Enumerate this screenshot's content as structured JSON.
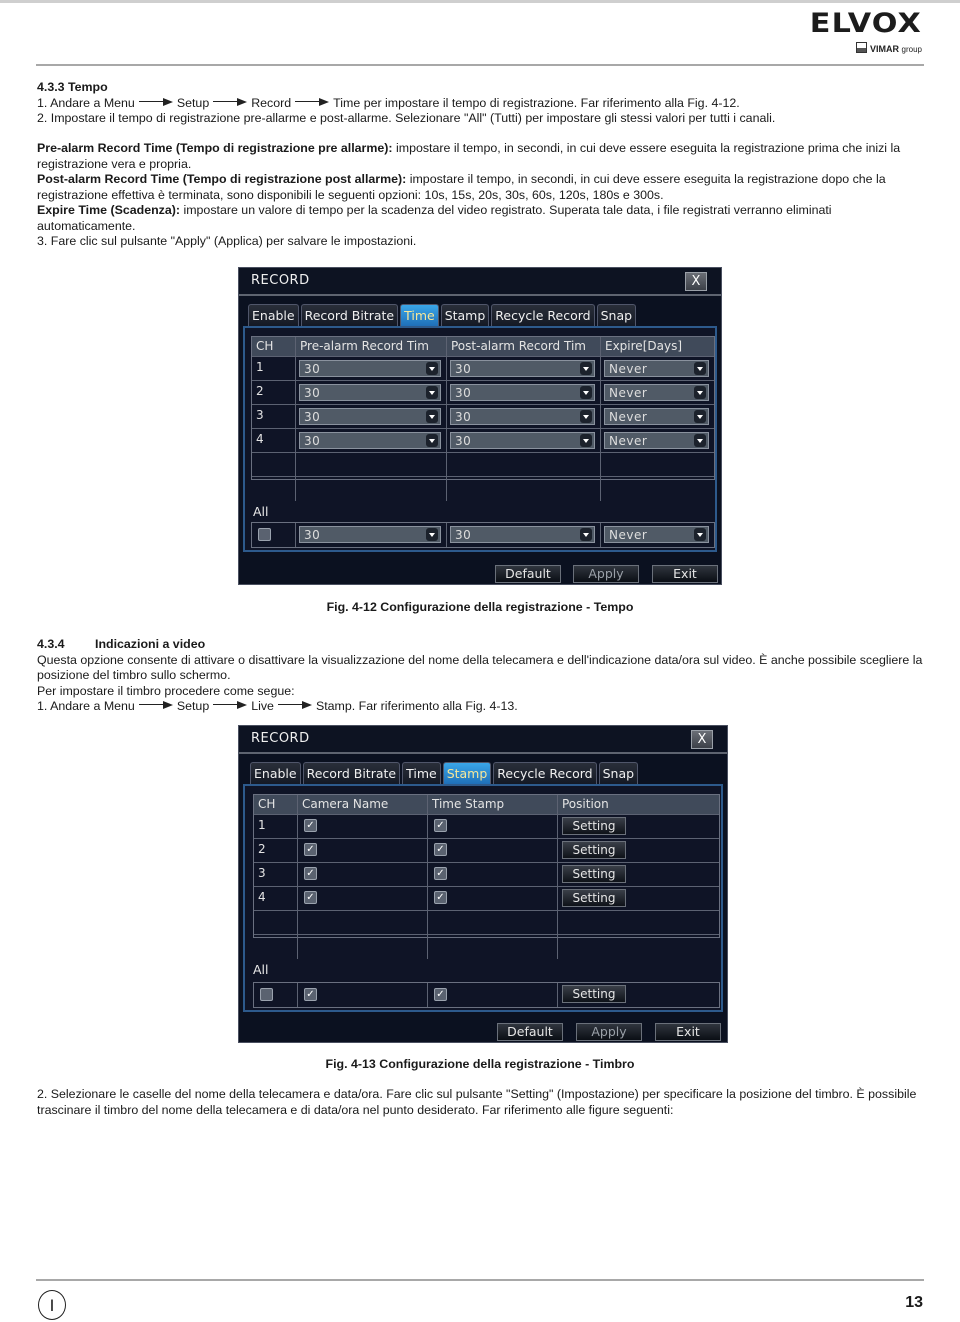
{
  "header": {
    "brand": "ELVOX",
    "sub_brand": "VIMAR",
    "sub_brand_suffix": "group"
  },
  "section_433": {
    "title": "4.3.3 Tempo",
    "step1": {
      "prefix": "1. Andare a Menu",
      "path": [
        "Setup",
        "Record"
      ],
      "suffix": "Time per impostare il tempo di registrazione. Far riferimento alla Fig. 4-12."
    },
    "step2": "2. Impostare il tempo di registrazione pre-allarme e post-allarme. Selezionare \"All\" (Tutti) per impostare gli stessi valori per tutti i canali.",
    "pre_alarm": {
      "label": "Pre-alarm Record Time (Tempo di registrazione pre allarme):",
      "text": " impostare il tempo, in secondi, in cui deve essere eseguita la registrazione prima che inizi la registrazione vera e propria."
    },
    "post_alarm": {
      "label": "Post-alarm Record Time (Tempo di registrazione post allarme):",
      "text": " impostare il tempo, in secondi, in cui deve essere eseguita la registrazione dopo che la registrazione effettiva è terminata, sono disponibili le seguenti opzioni: 10s, 15s, 20s, 30s, 60s, 120s, 180s e 300s."
    },
    "expire": {
      "label": "Expire Time (Scadenza):",
      "text": " impostare un valore di tempo per la scadenza del video registrato. Superata tale data, i file registrati verranno eliminati automaticamente."
    },
    "step3": "3. Fare clic sul pulsante \"Apply\" (Applica) per salvare le impostazioni."
  },
  "fig412": {
    "caption": "Fig. 4-12 Configurazione della registrazione - Tempo",
    "dialog": {
      "title": "RECORD",
      "close": "X",
      "tabs": [
        "Enable",
        "Record Bitrate",
        "Time",
        "Stamp",
        "Recycle Record",
        "Snap"
      ],
      "active_tab": "Time",
      "columns": [
        "CH",
        "Pre-alarm Record Tim",
        "Post-alarm Record Tim",
        "Expire[Days]"
      ],
      "rows": [
        {
          "ch": "1",
          "pre": "30",
          "post": "30",
          "expire": "Never"
        },
        {
          "ch": "2",
          "pre": "30",
          "post": "30",
          "expire": "Never"
        },
        {
          "ch": "3",
          "pre": "30",
          "post": "30",
          "expire": "Never"
        },
        {
          "ch": "4",
          "pre": "30",
          "post": "30",
          "expire": "Never"
        }
      ],
      "all_label": "All",
      "all_row": {
        "checked": false,
        "pre": "30",
        "post": "30",
        "expire": "Never"
      },
      "buttons": [
        "Default",
        "Apply",
        "Exit"
      ]
    }
  },
  "section_434": {
    "number": "4.3.4",
    "title": "Indicazioni a video",
    "intro": "Questa opzione consente di attivare o disattivare la visualizzazione del nome della telecamera e dell'indicazione data/ora sul video. È anche possibile scegliere la posizione del timbro sullo schermo.",
    "how": "Per impostare il timbro procedere come segue:",
    "step1": {
      "prefix": "1. Andare a Menu",
      "path": [
        "Setup",
        "Live"
      ],
      "suffix": "Stamp. Far riferimento alla Fig. 4-13."
    },
    "step2": "2. Selezionare le caselle del nome della telecamera e data/ora. Fare clic sul pulsante \"Setting\" (Impostazione) per specificare la posizione del timbro. È possibile trascinare il timbro del nome della telecamera e di data/ora nel punto desiderato. Far riferimento alle figure seguenti:"
  },
  "fig413": {
    "caption": "Fig. 4-13 Configurazione della registrazione - Timbro",
    "dialog": {
      "title": "RECORD",
      "close": "X",
      "tabs": [
        "Enable",
        "Record Bitrate",
        "Time",
        "Stamp",
        "Recycle Record",
        "Snap"
      ],
      "active_tab": "Stamp",
      "columns": [
        "CH",
        "Camera Name",
        "Time Stamp",
        "Position"
      ],
      "rows": [
        {
          "ch": "1",
          "camera_name": true,
          "time_stamp": true,
          "position": "Setting"
        },
        {
          "ch": "2",
          "camera_name": true,
          "time_stamp": true,
          "position": "Setting"
        },
        {
          "ch": "3",
          "camera_name": true,
          "time_stamp": true,
          "position": "Setting"
        },
        {
          "ch": "4",
          "camera_name": true,
          "time_stamp": true,
          "position": "Setting"
        }
      ],
      "all_label": "All",
      "all_row": {
        "checked": false,
        "camera_name": true,
        "time_stamp": true,
        "position": "Setting"
      },
      "buttons": [
        "Default",
        "Apply",
        "Exit"
      ]
    }
  },
  "footer": {
    "language": "I",
    "page_number": "13"
  }
}
